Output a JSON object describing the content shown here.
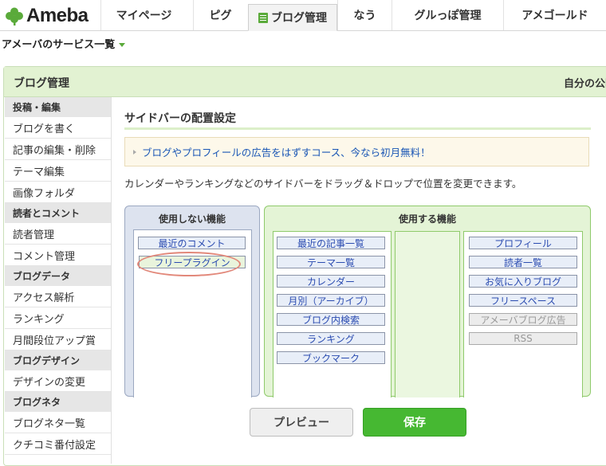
{
  "brand": {
    "name": "Ameba",
    "logo_icon": "ameba-clover-icon",
    "color": "#5aaa3a"
  },
  "nav": {
    "tabs": [
      {
        "label": "マイページ"
      },
      {
        "label": "ピグ"
      },
      {
        "label": "ブログ管理",
        "active": true,
        "icon": "blog-doc-icon"
      },
      {
        "label": "なう"
      },
      {
        "label": "グルっぽ管理"
      },
      {
        "label": "アメゴールド"
      }
    ]
  },
  "services_menu": {
    "label": "アメーバのサービス一覧"
  },
  "header": {
    "title": "ブログ管理",
    "right_text": "自分の公開"
  },
  "sidebar": {
    "sections": [
      {
        "heading": "投稿・編集",
        "items": [
          "ブログを書く",
          "記事の編集・削除",
          "テーマ編集",
          "画像フォルダ"
        ]
      },
      {
        "heading": "読者とコメント",
        "items": [
          "読者管理",
          "コメント管理"
        ]
      },
      {
        "heading": "ブログデータ",
        "items": [
          "アクセス解析",
          "ランキング",
          "月間段位アップ賞"
        ]
      },
      {
        "heading": "ブログデザイン",
        "items": [
          "デザインの変更"
        ]
      },
      {
        "heading": "ブログネタ",
        "items": [
          "ブログネタ一覧",
          "クチコミ番付設定"
        ]
      }
    ]
  },
  "main": {
    "title": "サイドバーの配置設定",
    "promo": "ブログやプロフィールの広告をはずすコース、今なら初月無料！",
    "description": "カレンダーやランキングなどのサイドバーをドラッグ＆ドロップで位置を変更できます。",
    "unused_panel": {
      "heading": "使用しない機能",
      "widgets": [
        "最近のコメント",
        "フリープラグイン"
      ]
    },
    "used_panel": {
      "heading": "使用する機能",
      "left_column": [
        "最近の記事一覧",
        "テーマ一覧",
        "カレンダー",
        "月別（アーカイブ）",
        "ブログ内検索",
        "ランキング",
        "ブックマーク"
      ],
      "right_column": [
        "プロフィール",
        "読者一覧",
        "お気に入りブログ",
        "フリースペース",
        "アメーバブログ広告",
        "RSS"
      ],
      "disabled_widgets": [
        "アメーバブログ広告",
        "RSS"
      ]
    },
    "buttons": {
      "preview": "プレビュー",
      "save": "保存"
    }
  },
  "colors": {
    "accent_green": "#46b832",
    "header_bg": "#e2f2d2",
    "highlight": "#e2887a"
  }
}
